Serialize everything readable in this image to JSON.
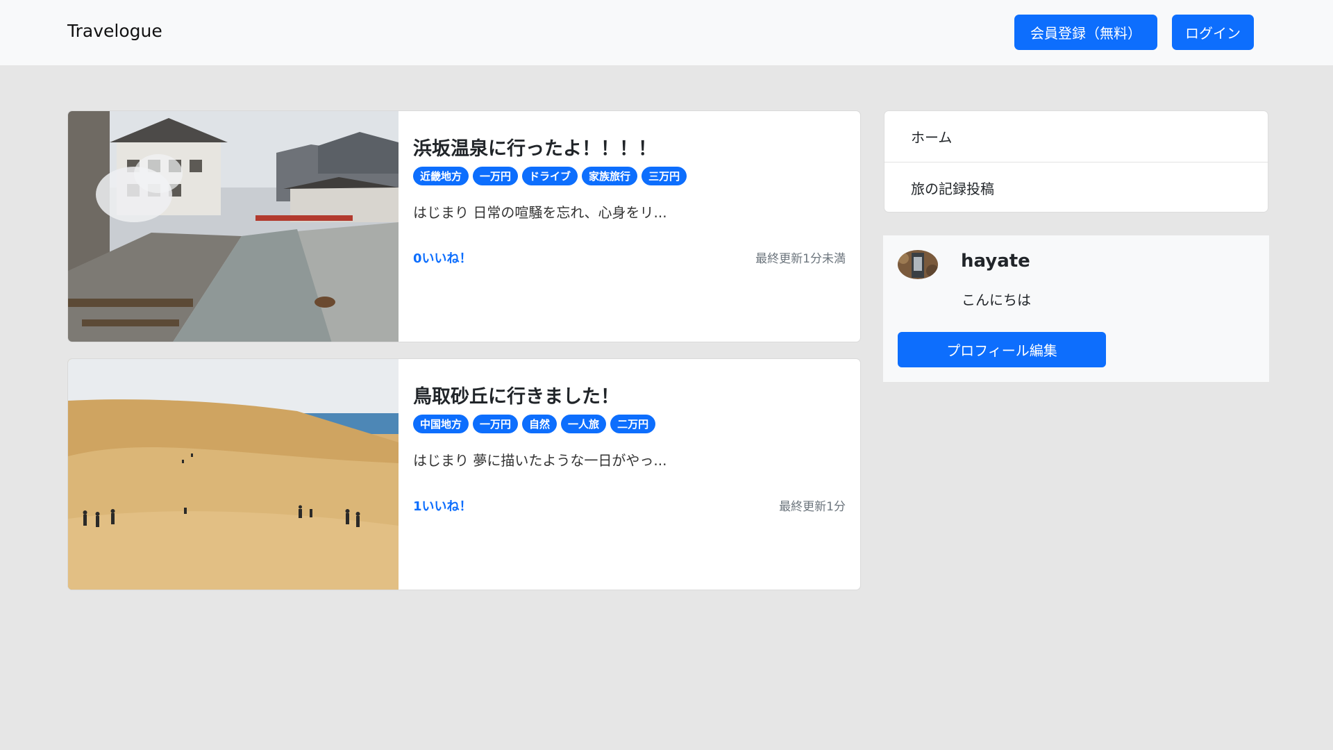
{
  "navbar": {
    "brand": "Travelogue",
    "signup_label": "会員登録（無料）",
    "login_label": "ログイン"
  },
  "posts": [
    {
      "title": "浜坂温泉に行ったよ！！！！",
      "tags": [
        "近畿地方",
        "一万円",
        "ドライブ",
        "家族旅行",
        "三万円"
      ],
      "excerpt": "はじまり 日常の喧騒を忘れ、心身をリ...",
      "likes": "0いいね！",
      "updated": "最終更新1分未満"
    },
    {
      "title": "鳥取砂丘に行きました！",
      "tags": [
        "中国地方",
        "一万円",
        "自然",
        "一人旅",
        "二万円"
      ],
      "excerpt": "はじまり 夢に描いたような一日がやっ...",
      "likes": "1いいね！",
      "updated": "最終更新1分"
    }
  ],
  "sidebar": {
    "menu": [
      {
        "label": "ホーム"
      },
      {
        "label": "旅の記録投稿"
      }
    ],
    "profile": {
      "username": "hayate",
      "bio": "こんにちは",
      "edit_label": "プロフィール編集"
    }
  },
  "colors": {
    "accent": "#0d6efd",
    "page_bg": "#e6e6e6",
    "navbar_bg": "#f8f9fa"
  }
}
